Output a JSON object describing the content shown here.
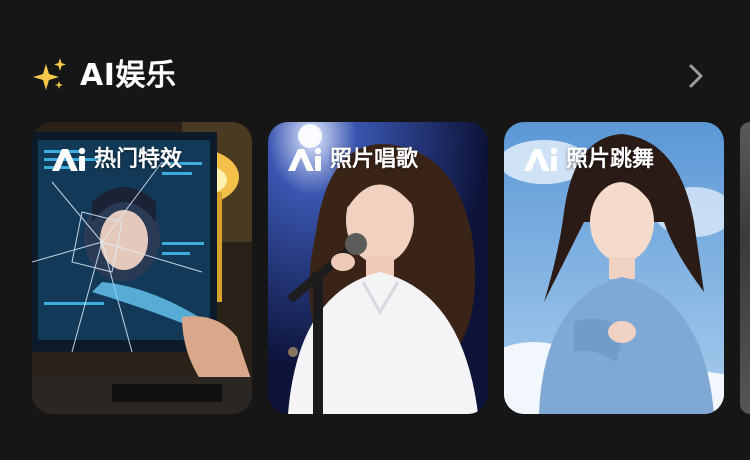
{
  "section": {
    "title": "AI娱乐",
    "sparkle_icon": "sparkles-icon",
    "more_icon": "chevron-right-icon"
  },
  "cards": [
    {
      "label": "热门特效",
      "badge_icon": "ai-badge-icon",
      "accent": "#3fb8ff"
    },
    {
      "label": "照片唱歌",
      "badge_icon": "ai-badge-icon",
      "accent": "#1d2e6e"
    },
    {
      "label": "照片跳舞",
      "badge_icon": "ai-badge-icon",
      "accent": "#7fb6e8"
    }
  ],
  "colors": {
    "background": "#161616",
    "text": "#ffffff",
    "sparkle": "#f6c94a"
  }
}
